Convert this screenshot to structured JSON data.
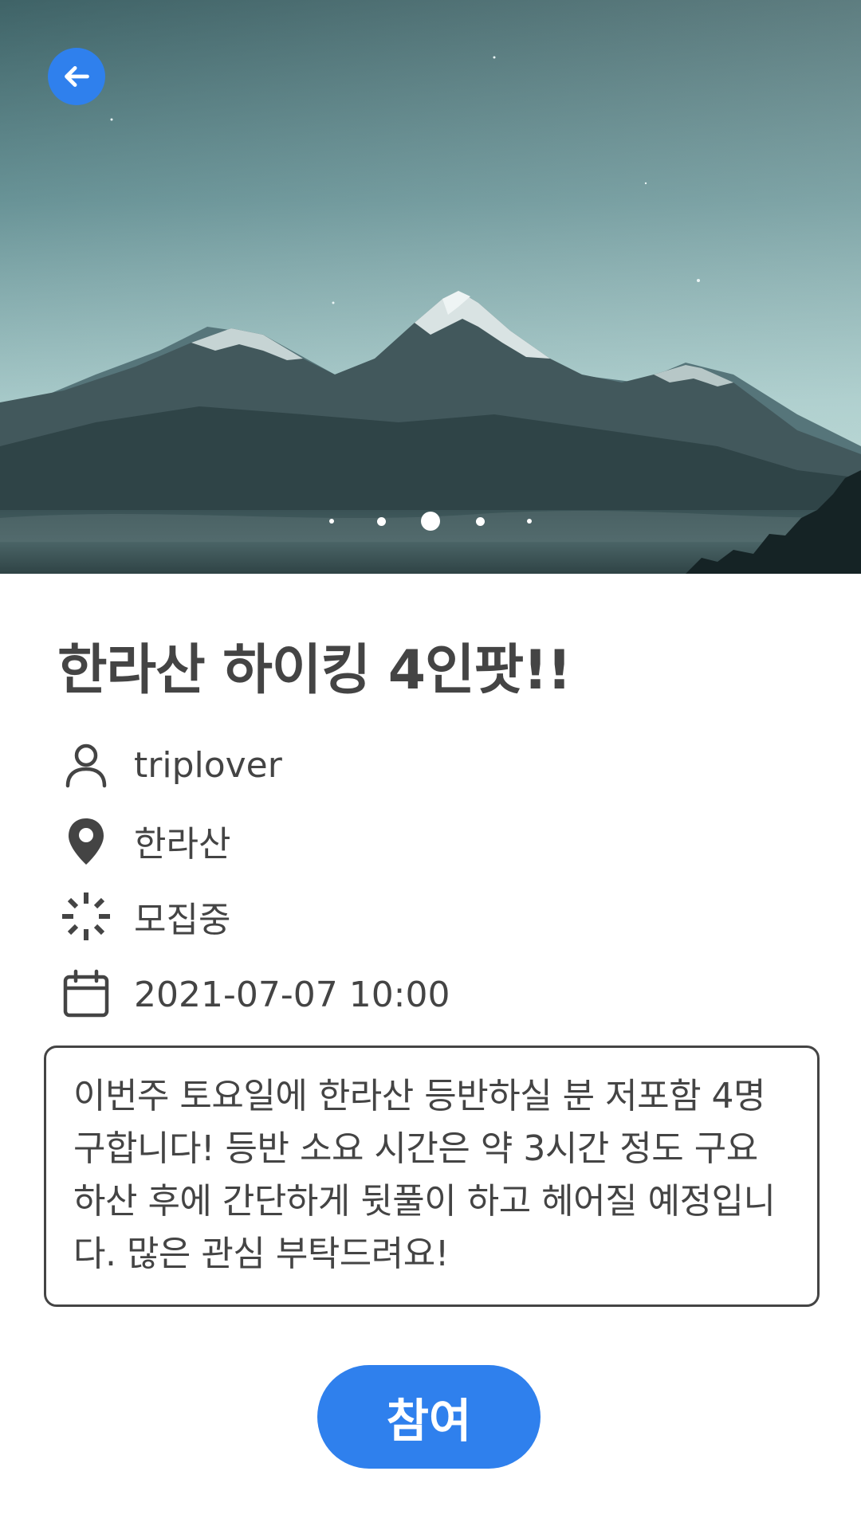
{
  "hero": {
    "image_name": "mountain-photo",
    "carousel": {
      "count": 5,
      "active_index": 2
    }
  },
  "post": {
    "title": "한라산 하이킹 4인팟!!",
    "author": "triplover",
    "location": "한라산",
    "status": "모집중",
    "datetime": "2021-07-07 10:00",
    "description": "이번주 토요일에 한라산 등반하실 분 저포함 4명 구합니다! 등반 소요 시간은 약 3시간 정도 구요 하산 후에 간단하게 뒷풀이 하고 헤어질 예정입니다. 많은 관심 부탁드려요!"
  },
  "actions": {
    "join_label": "참여"
  },
  "icons": {
    "back": "arrow-left-icon",
    "author": "person-icon",
    "location": "map-pin-icon",
    "status": "loading-spinner-icon",
    "datetime": "calendar-icon"
  },
  "colors": {
    "accent": "#2f80ed",
    "text": "#444444",
    "background": "#ffffff"
  }
}
